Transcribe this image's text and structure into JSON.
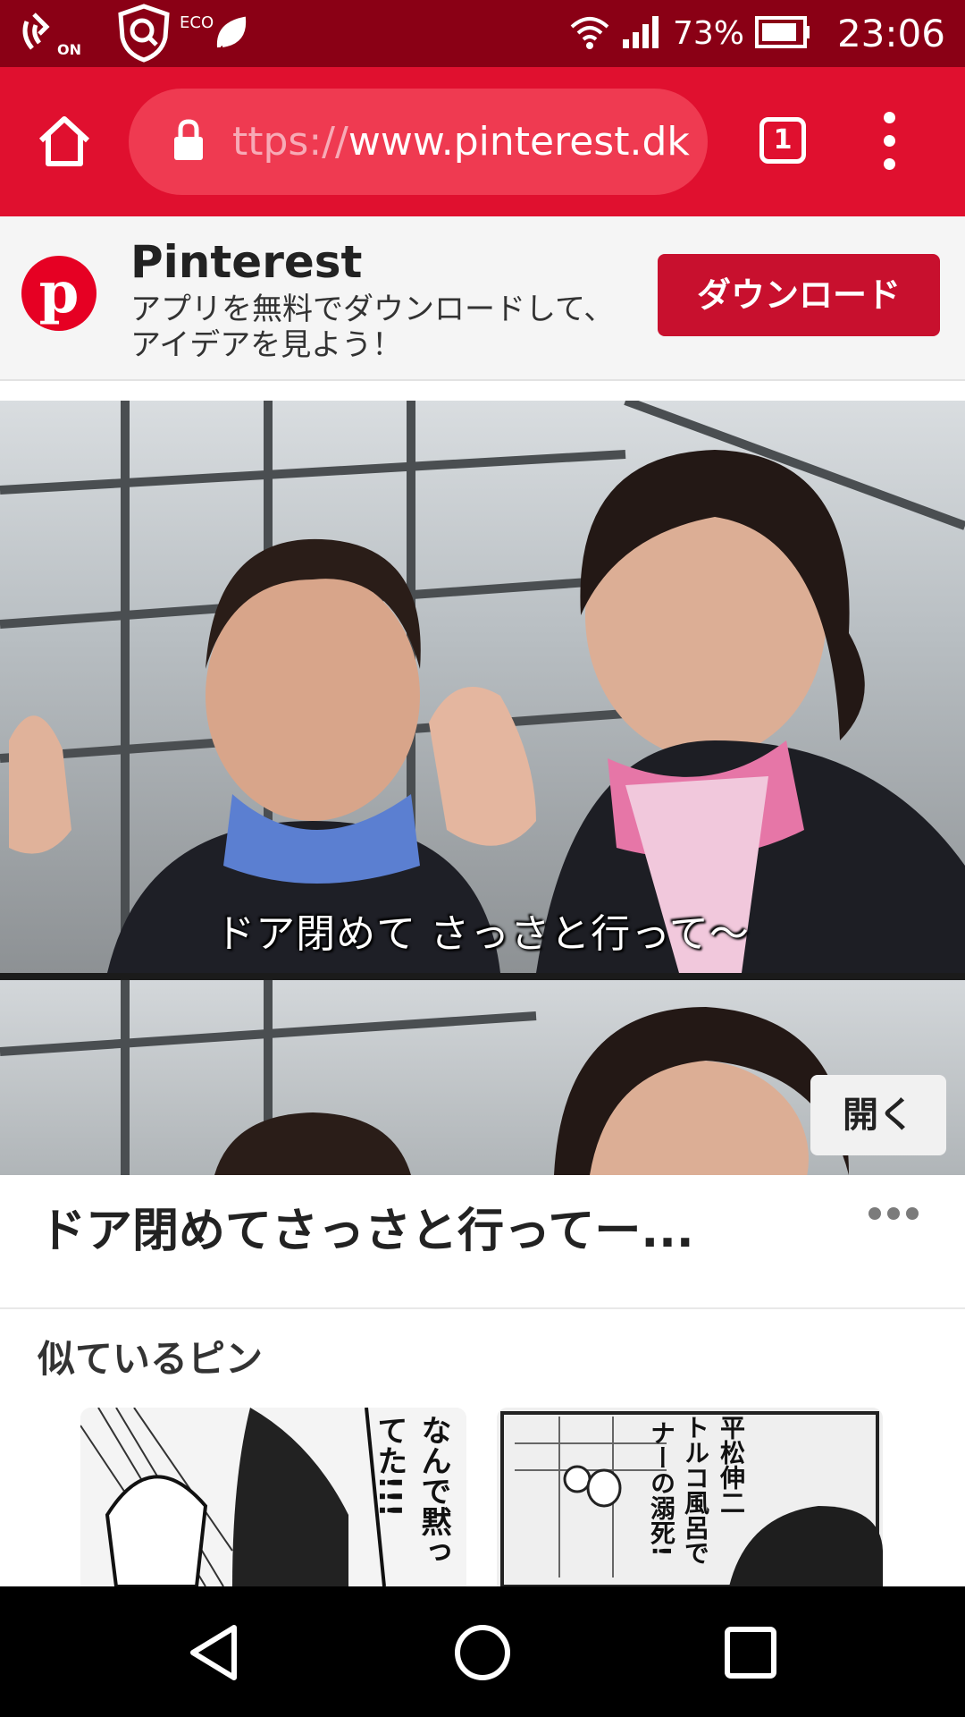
{
  "status_bar": {
    "nfc_label": "ON",
    "eco_label": "ECO",
    "battery_percent": "73%",
    "time": "23:06"
  },
  "browser": {
    "url_prefix": "ttps://",
    "url_host": "www.pinterest.dk",
    "tab_count": "1"
  },
  "app_banner": {
    "logo_letter": "p",
    "title": "Pinterest",
    "description": "アプリを無料でダウンロードして、アイデアを見よう！",
    "download_label": "ダウンロード"
  },
  "pin": {
    "subtitle": "ドア閉めて さっさと行って～",
    "open_label": "開く",
    "title": "ドア閉めてさっさと行ってー..."
  },
  "similar": {
    "heading": "似ているピン",
    "items": [
      {
        "caption": "なんで黙ってた!!!"
      },
      {
        "caption": "平松伸二",
        "caption2": "トルコ風呂で",
        "caption3": "ナーの溺死!"
      }
    ]
  },
  "colors": {
    "status_bar": "#8a0015",
    "toolbar": "#e0102f",
    "url_bar": "#ef3a51",
    "pinterest_red": "#e60023",
    "download_button": "#c8102e"
  }
}
